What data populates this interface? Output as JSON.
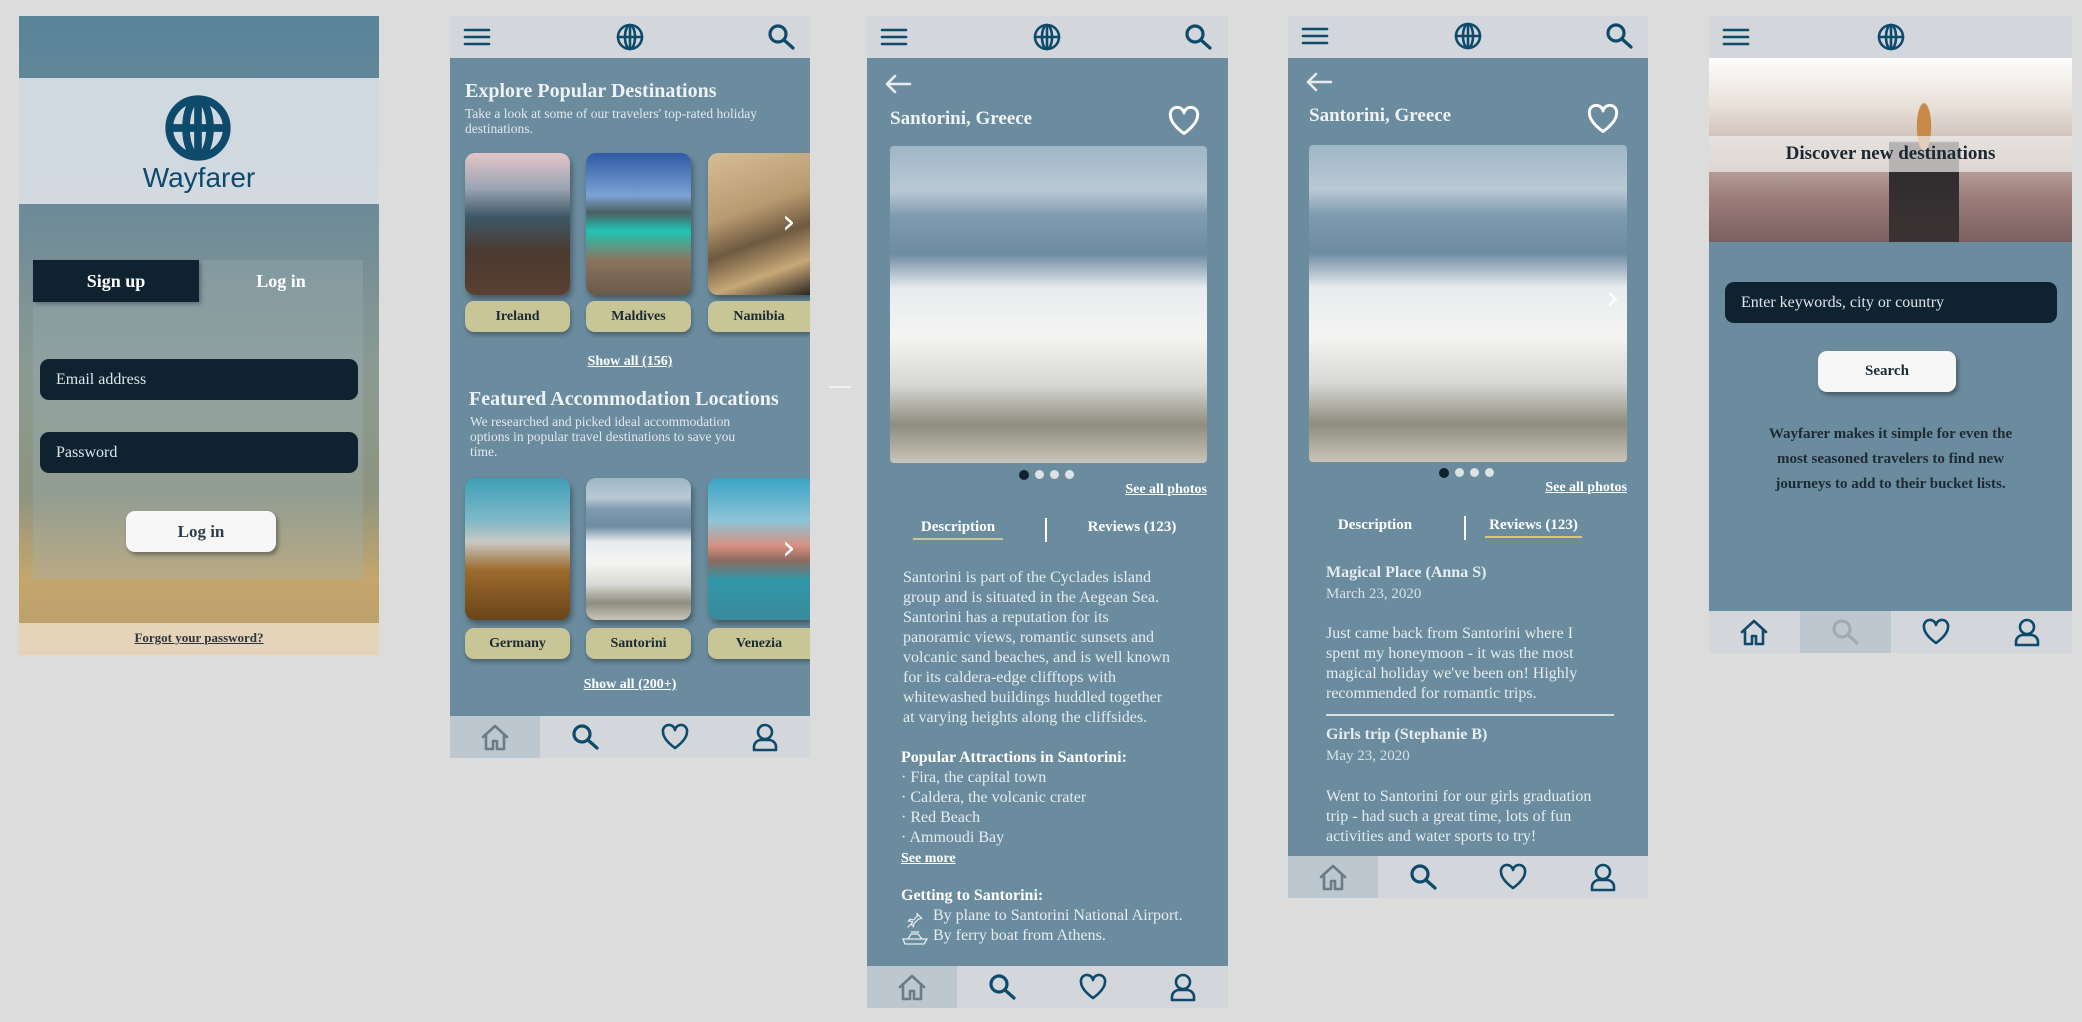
{
  "colors": {
    "panel": "#6a8c9e",
    "bar": "#d3d7db",
    "navy": "#0d4a6b",
    "tan": "#c8c596",
    "field": "#0f2230"
  },
  "login": {
    "brand": "Wayfarer",
    "tabs": [
      "Sign up",
      "Log in"
    ],
    "email_placeholder": "Email address",
    "password_placeholder": "Password",
    "login_button": "Log in",
    "forgot": "Forgot your password?"
  },
  "home": {
    "explore_title": "Explore Popular Destinations",
    "explore_sub": [
      "Take a look at some of our travelers' top-rated holiday",
      "destinations."
    ],
    "destinations": [
      "Ireland",
      "Maldives",
      "Namibia"
    ],
    "show_all_1": "Show all (156)",
    "featured_title": "Featured Accommodation Locations",
    "featured_sub": [
      "We researched and picked ideal accommodation",
      "options in popular travel destinations to save you",
      "time."
    ],
    "accommodations": [
      "Germany",
      "Santorini",
      "Venezia"
    ],
    "show_all_2": "Show all (200+)"
  },
  "detail": {
    "title": "Santorini, Greece",
    "see_all_photos": "See all photos",
    "tabs": [
      "Description",
      "Reviews (123)"
    ],
    "description": [
      "Santorini is part of the Cyclades island",
      "group and is situated in the Aegean Sea.",
      "Santorini has a reputation for its",
      "panoramic views, romantic sunsets and",
      "volcanic sand beaches, and is well known",
      "for its caldera-edge clifftops with",
      "whitewashed buildings huddled together",
      "at varying heights along the cliffsides."
    ],
    "attractions_title": "Popular Attractions in Santorini:",
    "attractions": [
      "· Fira, the capital town",
      "· Caldera, the volcanic crater",
      "· Red Beach",
      "· Ammoudi Bay"
    ],
    "see_more": "See more",
    "getting_title": "Getting to Santorini:",
    "getting": [
      "By plane to Santorini National Airport.",
      "By ferry boat from Athens."
    ]
  },
  "reviews": [
    {
      "title": "Magical Place (Anna S)",
      "date": "March 23, 2020",
      "body": [
        "Just came back from Santorini where I",
        "spent my honeymoon - it was the most",
        "magical holiday we've been on! Highly",
        "recommended for romantic trips."
      ]
    },
    {
      "title": "Girls trip (Stephanie B)",
      "date": "May 23, 2020",
      "body": [
        "Went to Santorini for our girls graduation",
        "trip - had such a great time, lots of fun",
        "activities and water sports to try!"
      ]
    }
  ],
  "search": {
    "hero": "Discover new destinations",
    "placeholder": "Enter keywords, city or country",
    "button": "Search",
    "blurb": [
      "Wayfarer makes it simple for even the",
      "most seasoned travelers to find new",
      "journeys to add to their bucket lists."
    ]
  },
  "icons": [
    "menu-icon",
    "globe-icon",
    "search-icon",
    "home-icon",
    "heart-icon",
    "user-icon",
    "back-arrow-icon",
    "plane-icon",
    "boat-icon"
  ]
}
